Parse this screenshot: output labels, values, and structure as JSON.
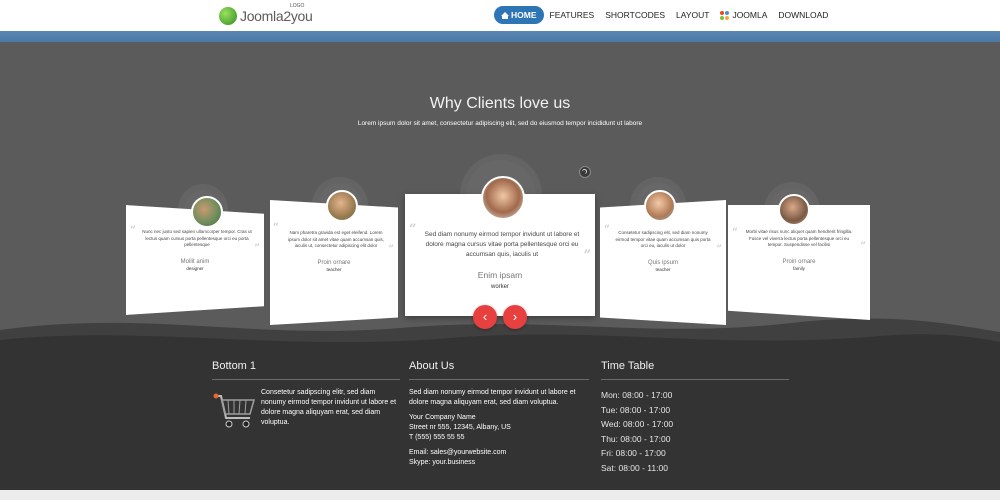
{
  "header": {
    "logo_text": "Joomla2you",
    "logo_sup": "LOGO",
    "nav": [
      {
        "label": "HOME",
        "active": true
      },
      {
        "label": "FEATURES"
      },
      {
        "label": "SHORTCODES"
      },
      {
        "label": "LAYOUT"
      },
      {
        "label": "JOOMLA"
      },
      {
        "label": "DOWNLOAD"
      }
    ]
  },
  "hero": {
    "title": "Why Clients love us",
    "subtitle": "Lorem ipsum dolor sit amet, consectetur adipiscing elit, sed do eiusmod tempor incididunt ut labore"
  },
  "testimonials": [
    {
      "text": "Nunc nec justo sed sapien ullamcorper tempor. Cras ut lectus quam cursus porta pellentesque orci eu porta pellentesque",
      "name": "Mollit anim",
      "role": "designer"
    },
    {
      "text": "Nam pharetra gravida est eget eleifend. Lorem ipsum dolor sit amet vitae quam accumsan quis, iaculis ut, consectetur adipiscing elit dolor",
      "name": "Proin ornare",
      "role": "teacher"
    },
    {
      "text": "Sed diam nonumy eirmod tempor invidunt ut labore et dolore magna cursus vitae porta pellentesque orci eu accumsan quis, iaculis ut",
      "name": "Enim ipsam",
      "role": "worker"
    },
    {
      "text": "Consetetur sadipscing elit, sed diam nonumy eirmod tempor vitae quam accumsan quis porta orci eu, iaculis ut dolor",
      "name": "Quis ipsum",
      "role": "teacher"
    },
    {
      "text": "Morbi vitae risus nunc aliquet quam hendrerit fringilla. Fusce vel viverra lectus porta pellentesque orci eu tempor. Suspendisse vel facilisi",
      "name": "Proin ornare",
      "role": "family"
    }
  ],
  "footer": {
    "bottom1": {
      "title": "Bottom 1",
      "text": "Consetetur sadipscing elitr, sed diam nonumy eirmod tempor invidunt ut labore et dolore magna aliquyam erat, sed diam voluptua."
    },
    "about": {
      "title": "About Us",
      "text": "Sed diam nonumy eirmod tempor invidunt ut labore et dolore magna aliquyam erat, sed diam voluptua.",
      "company": "Your Company Name",
      "street": "Street nr 555, 12345, Albany, US",
      "phone": "T (555) 555 55 55",
      "email": "Email: sales@yourwebsite.com",
      "skype": "Skype: your.business"
    },
    "timetable": {
      "title": "Time Table",
      "rows": [
        "Mon: 08:00 - 17:00",
        "Tue: 08:00 - 17:00",
        "Wed: 08:00 - 17:00",
        "Thu: 08:00 - 17:00",
        "Fri: 08:00 - 17:00",
        "Sat: 08:00 - 11:00"
      ]
    }
  },
  "icons": {
    "home": "home-icon",
    "joomla": "joomla-icon",
    "prev": "chevron-left-icon",
    "next": "chevron-right-icon",
    "cart": "shopping-cart-icon",
    "quote": "quote-icon"
  },
  "colors": {
    "accent": "#2e75b6",
    "arrow": "#e8403f",
    "band": "#4c78a6"
  }
}
